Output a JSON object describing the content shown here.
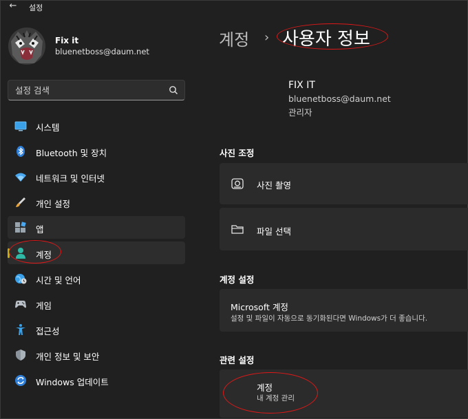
{
  "window": {
    "title": "설정",
    "back_icon": "back-arrow-icon"
  },
  "account": {
    "name": "Fix it",
    "email": "bluenetboss@daum.net"
  },
  "search": {
    "placeholder": "설정 검색",
    "icon": "search-icon"
  },
  "sidebar": {
    "items": [
      {
        "label": "시스템",
        "icon": "system-icon"
      },
      {
        "label": "Bluetooth 및 장치",
        "icon": "bluetooth-icon"
      },
      {
        "label": "네트워크 및 인터넷",
        "icon": "wifi-icon"
      },
      {
        "label": "개인 설정",
        "icon": "brush-icon"
      },
      {
        "label": "앱",
        "icon": "apps-icon"
      },
      {
        "label": "계정",
        "icon": "accounts-icon",
        "selected": true
      },
      {
        "label": "시간 및 언어",
        "icon": "time-language-icon"
      },
      {
        "label": "게임",
        "icon": "gamepad-icon"
      },
      {
        "label": "접근성",
        "icon": "accessibility-icon"
      },
      {
        "label": "개인 정보 및 보안",
        "icon": "shield-icon"
      },
      {
        "label": "Windows 업데이트",
        "icon": "windows-update-icon"
      }
    ]
  },
  "breadcrumb": {
    "parent": "계정",
    "separator": "›",
    "current": "사용자 정보"
  },
  "profile": {
    "name": "FIX IT",
    "email": "bluenetboss@daum.net",
    "role": "관리자"
  },
  "photo_section": {
    "title": "사진 조정",
    "items": [
      {
        "label": "사진 촬영",
        "icon": "camera-icon"
      },
      {
        "label": "파일 선택",
        "icon": "folder-icon"
      }
    ]
  },
  "account_settings": {
    "title": "계정 설정",
    "microsoft": {
      "title": "Microsoft 계정",
      "description": "설정 및 파일이 자동으로 동기화된다면 Windows가 더 좋습니다."
    }
  },
  "related": {
    "title": "관련 설정",
    "accounts": {
      "title": "계정",
      "description": "내 계정 관리"
    }
  },
  "colors": {
    "background": "#202020",
    "card": "#2b2b2b",
    "accent": "#c9b012",
    "annotation": "#e01818"
  }
}
